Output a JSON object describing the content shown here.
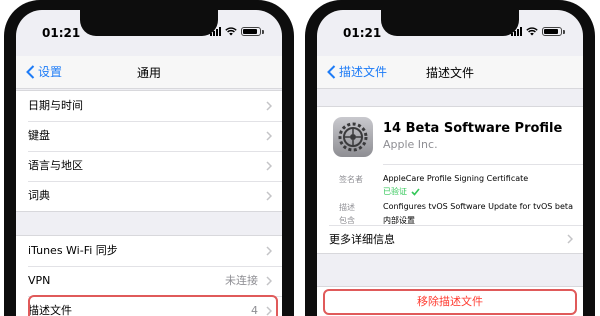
{
  "colors": {
    "accent": "#1e7cf7",
    "destructive": "#ff3b30",
    "verified": "#34c759",
    "highlight": "#e05a5a"
  },
  "left": {
    "status": {
      "time": "01:21"
    },
    "nav": {
      "back_label": "设置",
      "title": "通用"
    },
    "group1": [
      {
        "label": "日期与时间"
      },
      {
        "label": "键盘"
      },
      {
        "label": "语言与地区"
      },
      {
        "label": "词典"
      }
    ],
    "group2": [
      {
        "label": "iTunes Wi-Fi 同步",
        "value": ""
      },
      {
        "label": "VPN",
        "value": "未连接"
      },
      {
        "label": "描述文件",
        "value": "4"
      }
    ]
  },
  "right": {
    "status": {
      "time": "01:21"
    },
    "nav": {
      "back_label": "描述文件",
      "title": "描述文件"
    },
    "profile": {
      "name": "14 Beta Software Profile",
      "org": "Apple Inc.",
      "signed_by_label": "签名者",
      "signed_by_value": "AppleCare Profile Signing Certificate",
      "verified_label": "已验证",
      "description_label": "描述",
      "description_value": "Configures tvOS Software Update for tvOS beta",
      "contains_label": "包含",
      "contains_value": "内部设置",
      "more_label": "更多详细信息"
    },
    "remove_label": "移除描述文件"
  }
}
